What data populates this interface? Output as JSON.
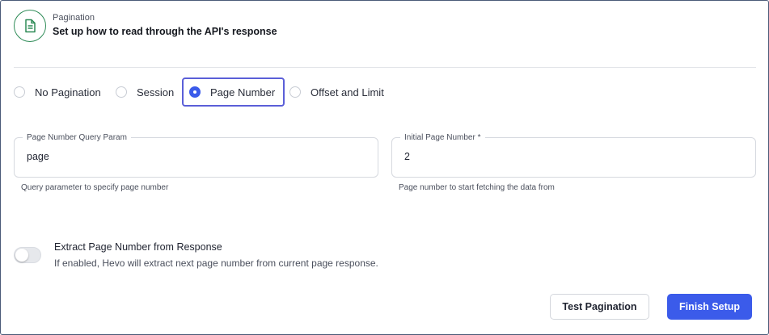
{
  "header": {
    "eyebrow": "Pagination",
    "title": "Set up how to read through the API's response",
    "icon": "document-icon",
    "icon_color": "#2e8b57"
  },
  "pagination_options": [
    {
      "label": "No Pagination",
      "selected": false
    },
    {
      "label": "Session",
      "selected": false
    },
    {
      "label": "Page Number",
      "selected": true
    },
    {
      "label": "Offset and Limit",
      "selected": false
    }
  ],
  "fields": {
    "query_param": {
      "label": "Page Number Query Param",
      "value": "page",
      "hint": "Query parameter to specify page number"
    },
    "initial_page": {
      "label": "Initial Page Number *",
      "value": "2",
      "hint": "Page number to start fetching the data from"
    }
  },
  "extract_toggle": {
    "title": "Extract Page Number from Response",
    "description": "If enabled, Hevo will extract next page number from current page response.",
    "enabled": false
  },
  "actions": {
    "test_label": "Test Pagination",
    "finish_label": "Finish Setup"
  },
  "colors": {
    "accent": "#3b5bea",
    "selected_border": "#5b5fd8"
  }
}
